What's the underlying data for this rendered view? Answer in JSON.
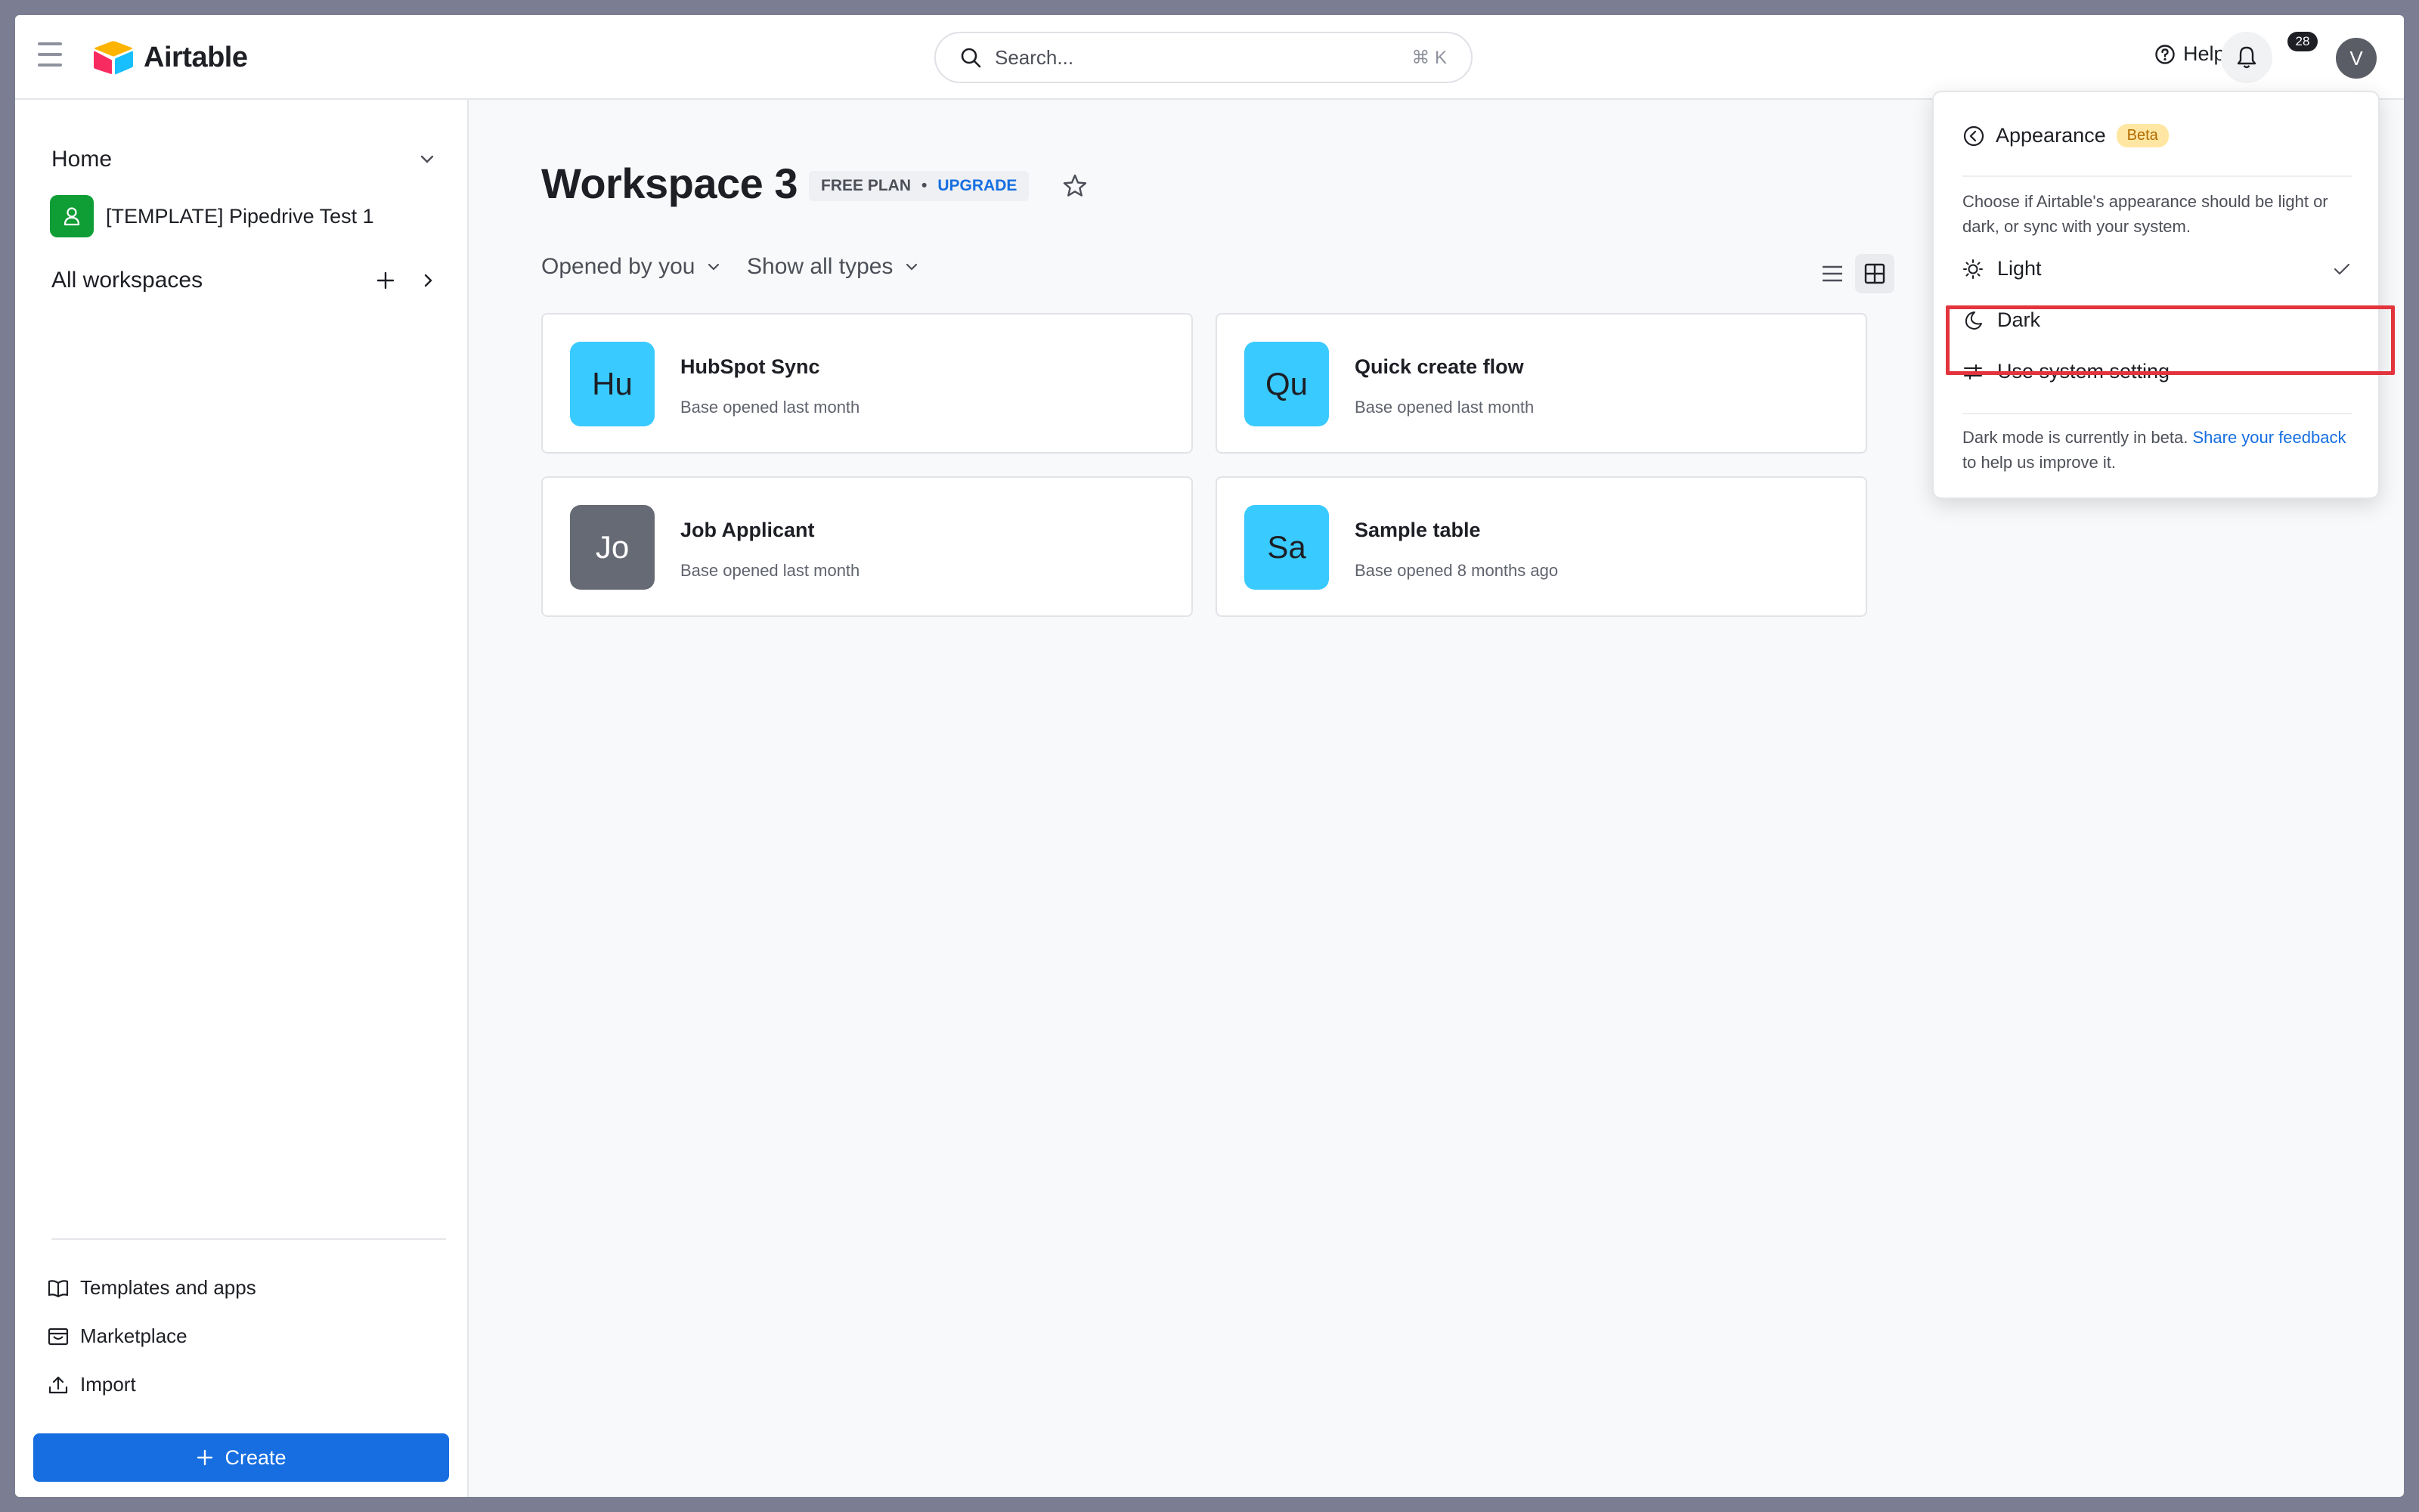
{
  "topbar": {
    "app_name": "Airtable",
    "search_placeholder": "Search...",
    "search_shortcut": "⌘ K",
    "help_label": "Help",
    "notification_count": "28",
    "avatar_initial": "V"
  },
  "sidebar": {
    "home_label": "Home",
    "base_item": "[TEMPLATE] Pipedrive Test 1",
    "all_workspaces_label": "All workspaces",
    "links": [
      {
        "label": "Templates and apps",
        "icon": "book-icon"
      },
      {
        "label": "Marketplace",
        "icon": "store-icon"
      },
      {
        "label": "Import",
        "icon": "upload-icon"
      }
    ],
    "create_label": "Create",
    "colors": {
      "create": "#166ee1",
      "base_icon": "#0f9d35"
    }
  },
  "main": {
    "workspace_title": "Workspace 3",
    "plan_label": "FREE PLAN",
    "plan_separator": "•",
    "upgrade_label": "UPGRADE",
    "filter_opened": "Opened by you",
    "filter_types": "Show all types",
    "cards": [
      {
        "initials": "Hu",
        "name": "HubSpot Sync",
        "subtitle": "Base opened last month",
        "color": "#39caff"
      },
      {
        "initials": "Qu",
        "name": "Quick create flow",
        "subtitle": "Base opened last month",
        "color": "#39caff"
      },
      {
        "initials": "Jo",
        "name": "Job Applicant",
        "subtitle": "Base opened last month",
        "color": "#666a74"
      },
      {
        "initials": "Sa",
        "name": "Sample table",
        "subtitle": "Base opened 8 months ago",
        "color": "#39caff"
      }
    ]
  },
  "appearance": {
    "title": "Appearance",
    "badge": "Beta",
    "description": "Choose if Airtable's appearance should be light or dark, or sync with your system.",
    "options": [
      {
        "label": "Light",
        "icon": "sun-icon",
        "selected": true
      },
      {
        "label": "Dark",
        "icon": "moon-icon",
        "selected": false
      },
      {
        "label": "Use system setting",
        "icon": "sliders-icon",
        "selected": false
      }
    ],
    "footer_text": "Dark mode is currently in beta.",
    "footer_link": "Share your feedback",
    "footer_tail": "to help us improve it.",
    "highlight_color": "#e3343d"
  }
}
